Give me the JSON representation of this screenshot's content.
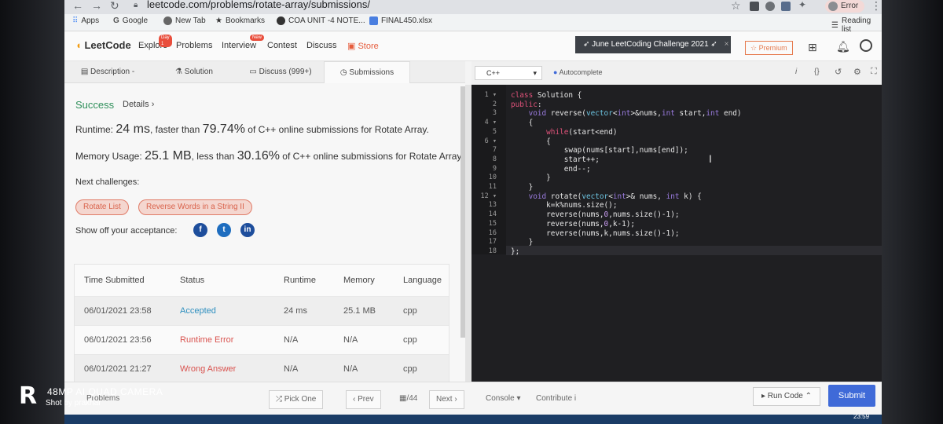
{
  "browser": {
    "url": "leetcode.com/problems/rotate-array/submissions/",
    "profile_badge": "Error",
    "bookmarks": [
      "Apps",
      "Google",
      "New Tab",
      "Bookmarks",
      "COA UNIT -4 NOTE...",
      "FINAL450.xlsx"
    ],
    "reading_list": "Reading list"
  },
  "navbar": {
    "logo": "LeetCode",
    "items": [
      "Explore",
      "Problems",
      "Interview",
      "Contest",
      "Discuss",
      "Store"
    ],
    "explore_badge": "Day 1",
    "interview_badge": "New",
    "challenge": "June LeetCoding Challenge 2021",
    "premium": "Premium"
  },
  "left_tabs": [
    "Description",
    "Solution",
    "Discuss (999+)",
    "Submissions"
  ],
  "result": {
    "status": "Success",
    "details": "Details",
    "runtime_label": "Runtime:",
    "runtime_value": "24 ms",
    "runtime_mid": ", faster than",
    "runtime_pct": "79.74%",
    "runtime_tail": "of C++ online submissions for Rotate Array.",
    "memory_label": "Memory Usage:",
    "memory_value": "25.1 MB",
    "memory_mid": ", less than",
    "memory_pct": "30.16%",
    "memory_tail": "of C++ online submissions for Rotate Array.",
    "next_label": "Next challenges:",
    "challenges": [
      "Rotate List",
      "Reverse Words in a String II"
    ],
    "share_label": "Show off your acceptance:"
  },
  "submissions": {
    "headers": [
      "Time Submitted",
      "Status",
      "Runtime",
      "Memory",
      "Language"
    ],
    "rows": [
      [
        "06/01/2021 23:58",
        "Accepted",
        "24 ms",
        "25.1 MB",
        "cpp"
      ],
      [
        "06/01/2021 23:56",
        "Runtime Error",
        "N/A",
        "N/A",
        "cpp"
      ],
      [
        "06/01/2021 21:27",
        "Wrong Answer",
        "N/A",
        "N/A",
        "cpp"
      ]
    ]
  },
  "editor": {
    "language": "C++",
    "autocomplete": "Autocomplete",
    "lines": [
      "class Solution {",
      "public:",
      "    void reverse(vector<int>&nums,int start,int end)",
      "    {",
      "        while(start<end)",
      "        {",
      "            swap(nums[start],nums[end]);",
      "            start++;",
      "            end--;",
      "        }",
      "    }",
      "    void rotate(vector<int>& nums, int k) {",
      "        k=k%nums.size();",
      "        reverse(nums,0,nums.size()-1);",
      "        reverse(nums,0,k-1);",
      "        reverse(nums,k,nums.size()-1);",
      "    }",
      "};"
    ]
  },
  "bottom_bar": {
    "problems": "Problems",
    "pick_one": "Pick One",
    "prev": "Prev",
    "page": "/44",
    "next": "Next",
    "console": "Console",
    "contribute": "Contribute",
    "run_code": "Run Code",
    "submit": "Submit"
  },
  "taskbar": {
    "clock": "23:59"
  },
  "watermark": {
    "line1": "48MP AI QUAD CAMERA",
    "line2": "Shot by prakhar"
  },
  "colors": {
    "accent": "#3f6ad8",
    "success": "#2e8fbf",
    "error": "#d9534f",
    "editor_bg": "#1f1f22"
  }
}
